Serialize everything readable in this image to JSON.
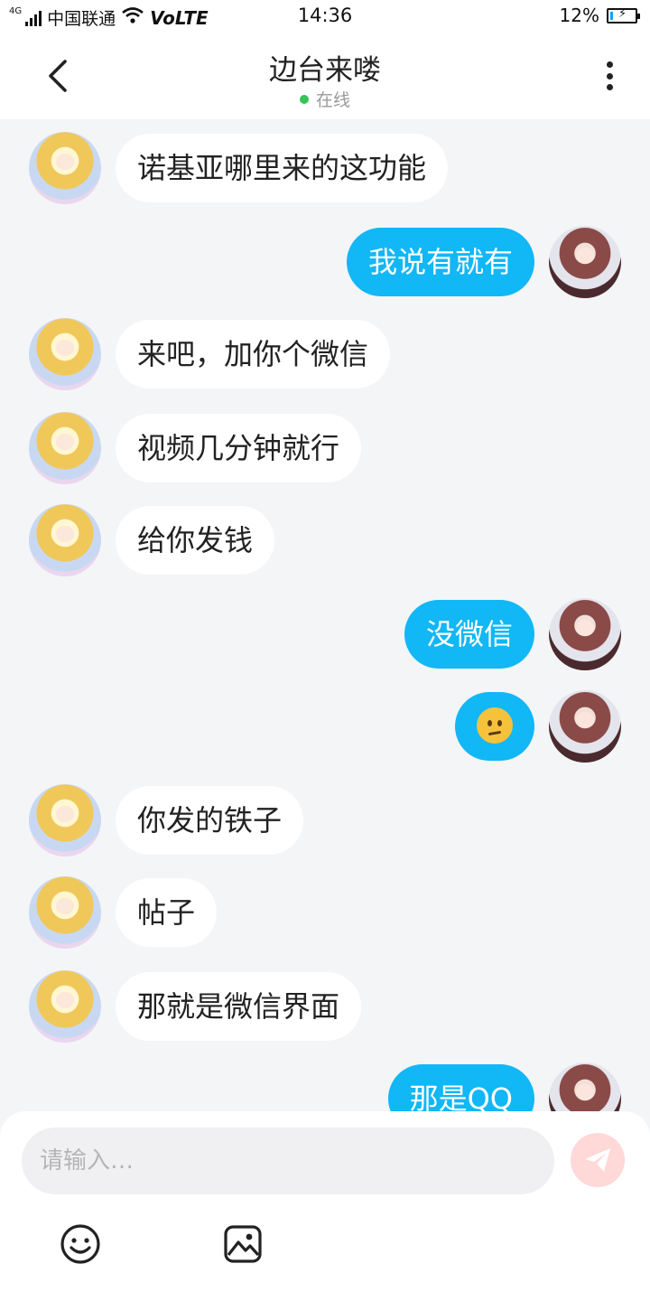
{
  "status_bar": {
    "network_type": "4G",
    "carrier": "中国联通",
    "volte": "VoLTE",
    "time": "14:36",
    "battery_percent": "12%",
    "battery_level": 0.12
  },
  "header": {
    "title": "边台来喽",
    "status": "在线",
    "status_color": "#35c45a"
  },
  "messages": [
    {
      "side": "in",
      "text": "诺基亚哪里来的这功能"
    },
    {
      "side": "out",
      "text": "我说有就有"
    },
    {
      "side": "in",
      "text": "来吧，加你个微信"
    },
    {
      "side": "in",
      "text": "视频几分钟就行"
    },
    {
      "side": "in",
      "text": "给你发钱"
    },
    {
      "side": "out",
      "text": "没微信"
    },
    {
      "side": "out",
      "emoji": "confused-face"
    },
    {
      "side": "in",
      "text": "你发的铁子"
    },
    {
      "side": "in",
      "text": "帖子"
    },
    {
      "side": "in",
      "text": "那就是微信界面"
    },
    {
      "side": "out",
      "text": "那是QQ"
    }
  ],
  "composer": {
    "placeholder": "请输入…",
    "send_icon": "paper-plane-icon",
    "tools": [
      "smiley-icon",
      "image-icon"
    ]
  },
  "colors": {
    "outgoing_bubble": "#12b7f5",
    "incoming_bubble": "#ffffff",
    "background": "#f4f5f7",
    "send_button": "#ffd8d8"
  }
}
